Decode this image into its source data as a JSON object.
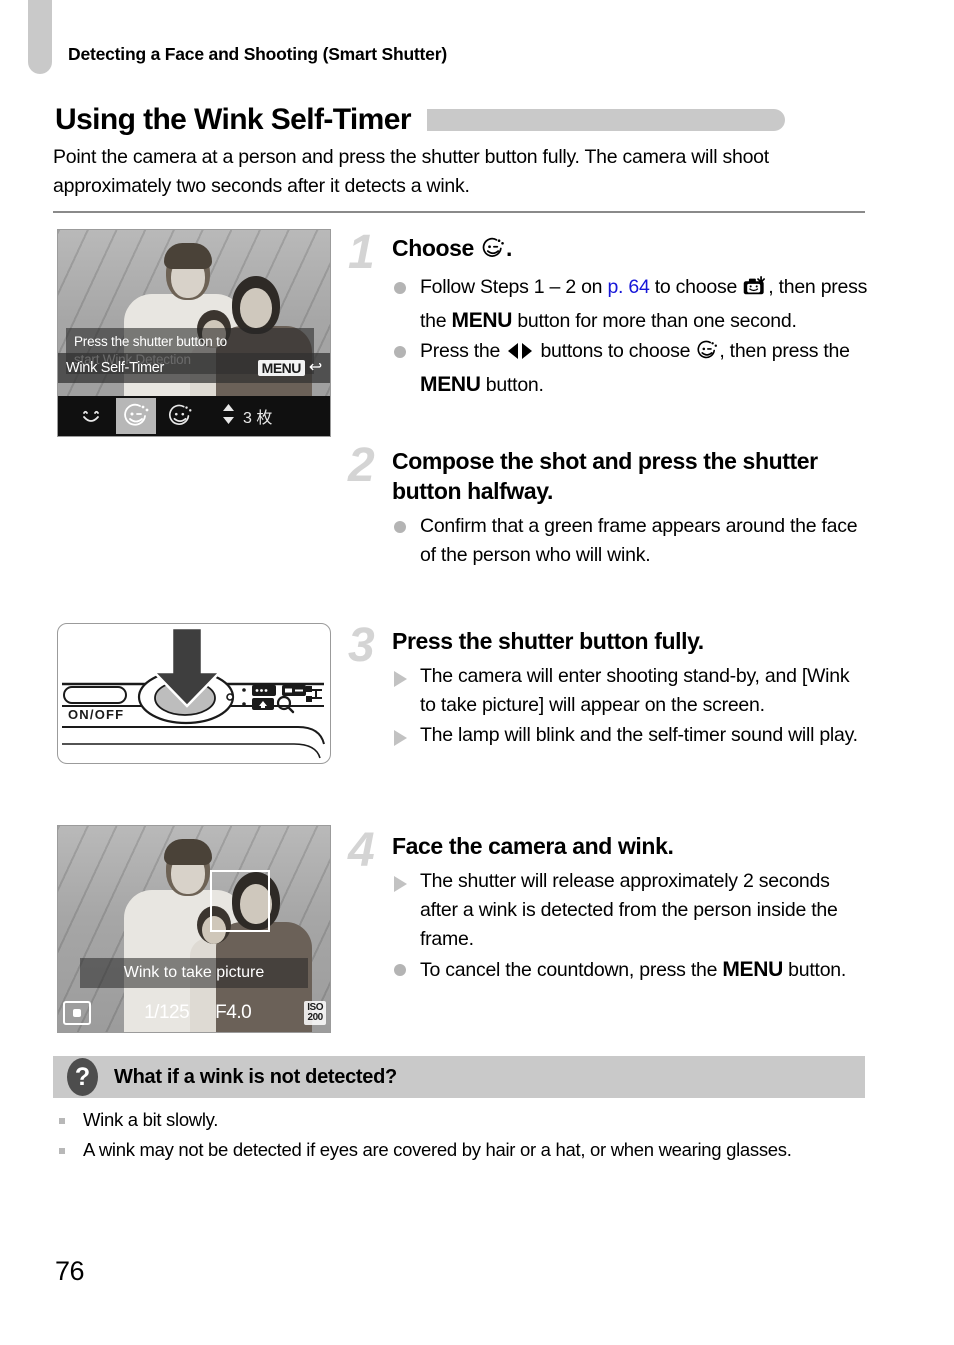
{
  "header": {
    "running_title": "Detecting a Face and Shooting (Smart Shutter)"
  },
  "section": {
    "title": "Using the Wink Self-Timer",
    "intro": "Point the camera at a person and press the shutter button fully. The camera will shoot approximately two seconds after it detects a wink."
  },
  "figures": {
    "lcd1": {
      "banner_line1": "Press the shutter button to",
      "banner_line2": "start Wink Detection",
      "mode_label": "Wink Self-Timer",
      "menu_label": "MENU",
      "return_arrow": "↰",
      "icons": [
        "smile-detection-icon",
        "wink-self-timer-icon",
        "face-self-timer-icon"
      ],
      "selected_icon_index": 1,
      "shot_count": "3 枚"
    },
    "camera": {
      "power_label": "ON/OFF",
      "arrow": "press-down-arrow"
    },
    "lcd2": {
      "banner": "Wink to take picture",
      "shutter_speed": "1/125",
      "aperture": "F4.0",
      "iso_top": "ISO",
      "iso_value": "200"
    }
  },
  "steps": [
    {
      "number": "1",
      "title_prefix": "Choose ",
      "title_icon": "wink-self-timer-icon",
      "title_suffix": ".",
      "bullets": [
        {
          "marker": "dot",
          "parts": [
            {
              "t": "text",
              "v": "Follow Steps 1 – 2 on "
            },
            {
              "t": "pageref",
              "v": "p. 64"
            },
            {
              "t": "text",
              "v": " to choose "
            },
            {
              "t": "icon",
              "v": "face-self-timer-camera-icon"
            },
            {
              "t": "text",
              "v": ", then press the "
            },
            {
              "t": "menu",
              "v": "MENU"
            },
            {
              "t": "text",
              "v": " button for more than one second."
            }
          ]
        },
        {
          "marker": "dot",
          "parts": [
            {
              "t": "text",
              "v": "Press the "
            },
            {
              "t": "icon",
              "v": "left-right-arrows-icon"
            },
            {
              "t": "text",
              "v": " buttons to choose "
            },
            {
              "t": "icon",
              "v": "wink-self-timer-icon"
            },
            {
              "t": "text",
              "v": ", then press the "
            },
            {
              "t": "menu",
              "v": "MENU"
            },
            {
              "t": "text",
              "v": " button."
            }
          ]
        }
      ]
    },
    {
      "number": "2",
      "title": "Compose the shot and press the shutter button halfway.",
      "bullets": [
        {
          "marker": "dot",
          "parts": [
            {
              "t": "text",
              "v": "Confirm that a green frame appears around the face of the person who will wink."
            }
          ]
        }
      ]
    },
    {
      "number": "3",
      "title": "Press the shutter button fully.",
      "bullets": [
        {
          "marker": "tri",
          "parts": [
            {
              "t": "text",
              "v": "The camera will enter shooting stand-by, and [Wink to take picture] will appear on the screen."
            }
          ]
        },
        {
          "marker": "tri",
          "parts": [
            {
              "t": "text",
              "v": "The lamp will blink and the self-timer sound will play."
            }
          ]
        }
      ]
    },
    {
      "number": "4",
      "title": "Face the camera and wink.",
      "bullets": [
        {
          "marker": "tri",
          "parts": [
            {
              "t": "text",
              "v": "The shutter will release approximately 2 seconds after a wink is detected from the person inside the frame."
            }
          ]
        },
        {
          "marker": "dot",
          "parts": [
            {
              "t": "text",
              "v": "To cancel the countdown, press the "
            },
            {
              "t": "menu",
              "v": "MENU"
            },
            {
              "t": "text",
              "v": " button."
            }
          ]
        }
      ]
    }
  ],
  "question_box": {
    "icon": "question-mark-icon",
    "icon_glyph": "?",
    "title": "What if a wink is not detected?",
    "items": [
      "Wink a bit slowly.",
      "A wink may not be detected if eyes are covered by hair or a hat, or when wearing glasses."
    ]
  },
  "folio": "76",
  "colors": {
    "accent_gray": "#c9c9c9",
    "link_blue": "#1616d8",
    "step_number_gray": "#d4d4d4",
    "rule_gray": "#8a8a8a"
  }
}
